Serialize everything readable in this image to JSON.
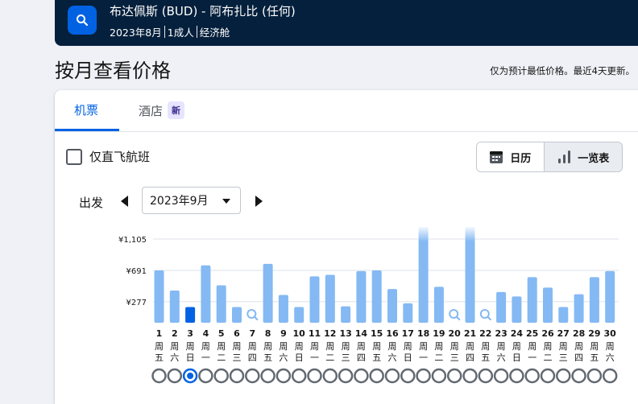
{
  "header": {
    "route": "布达佩斯 (BUD) - 阿布扎比 (任何)",
    "date": "2023年8月",
    "travelers": "1成人",
    "cabin": "经济舱"
  },
  "page": {
    "title": "按月查看价格",
    "note": "仅为预计最低价格。最近4天更新。"
  },
  "tabs": {
    "flights": "机票",
    "hotels": "酒店",
    "hotels_badge": "新"
  },
  "filters": {
    "direct_only": "仅直飞航班"
  },
  "view_toggle": {
    "calendar": "日历",
    "list": "一览表"
  },
  "depart": {
    "label": "出发",
    "month": "2023年9月"
  },
  "colors": {
    "accent": "#0062e3",
    "bar": "#84b9f3",
    "bar_selected": "#0062e3",
    "header_bg": "#05203c"
  },
  "chart_data": {
    "type": "bar",
    "yticks": [
      "¥1,105",
      "¥691",
      "¥277"
    ],
    "ytick_values": [
      1105,
      691,
      277
    ],
    "ylim": [
      0,
      1105
    ],
    "selected_index": 2,
    "days": [
      {
        "d": "1",
        "w": [
          "周",
          "五"
        ],
        "v": 691
      },
      {
        "d": "2",
        "w": [
          "周",
          "六"
        ],
        "v": 425
      },
      {
        "d": "3",
        "w": [
          "周",
          "日"
        ],
        "v": 207
      },
      {
        "d": "4",
        "w": [
          "周",
          "一"
        ],
        "v": 757
      },
      {
        "d": "5",
        "w": [
          "周",
          "二"
        ],
        "v": 494
      },
      {
        "d": "6",
        "w": [
          "周",
          "三"
        ],
        "v": 207
      },
      {
        "d": "7",
        "w": [
          "周",
          "四"
        ],
        "v": null
      },
      {
        "d": "8",
        "w": [
          "周",
          "五"
        ],
        "v": 777
      },
      {
        "d": "9",
        "w": [
          "周",
          "六"
        ],
        "v": 366
      },
      {
        "d": "10",
        "w": [
          "周",
          "日"
        ],
        "v": 207
      },
      {
        "d": "11",
        "w": [
          "周",
          "一"
        ],
        "v": 612
      },
      {
        "d": "12",
        "w": [
          "周",
          "二"
        ],
        "v": 632
      },
      {
        "d": "13",
        "w": [
          "周",
          "三"
        ],
        "v": 217
      },
      {
        "d": "14",
        "w": [
          "周",
          "四"
        ],
        "v": 681
      },
      {
        "d": "15",
        "w": [
          "周",
          "五"
        ],
        "v": 691
      },
      {
        "d": "16",
        "w": [
          "周",
          "六"
        ],
        "v": 445
      },
      {
        "d": "17",
        "w": [
          "周",
          "日"
        ],
        "v": 256
      },
      {
        "d": "18",
        "w": [
          "周",
          "一"
        ],
        "v": 1105
      },
      {
        "d": "19",
        "w": [
          "周",
          "二"
        ],
        "v": 474
      },
      {
        "d": "20",
        "w": [
          "周",
          "三"
        ],
        "v": null
      },
      {
        "d": "21",
        "w": [
          "周",
          "四"
        ],
        "v": 1105
      },
      {
        "d": "22",
        "w": [
          "周",
          "五"
        ],
        "v": null
      },
      {
        "d": "23",
        "w": [
          "周",
          "六"
        ],
        "v": 405
      },
      {
        "d": "24",
        "w": [
          "周",
          "日"
        ],
        "v": 346
      },
      {
        "d": "25",
        "w": [
          "周",
          "一"
        ],
        "v": 602
      },
      {
        "d": "26",
        "w": [
          "周",
          "二"
        ],
        "v": 464
      },
      {
        "d": "27",
        "w": [
          "周",
          "三"
        ],
        "v": 207
      },
      {
        "d": "28",
        "w": [
          "周",
          "四"
        ],
        "v": 376
      },
      {
        "d": "29",
        "w": [
          "周",
          "五"
        ],
        "v": 602
      },
      {
        "d": "30",
        "w": [
          "周",
          "六"
        ],
        "v": 681
      }
    ]
  }
}
